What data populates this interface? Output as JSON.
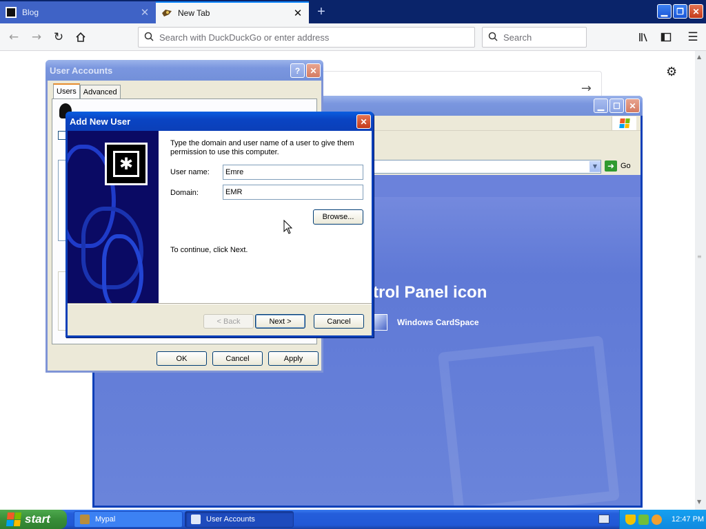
{
  "browser": {
    "tabs": [
      {
        "label": "Blog",
        "active": false
      },
      {
        "label": "New Tab",
        "active": true
      }
    ],
    "close_glyph": "✕",
    "new_tab_glyph": "+",
    "address_placeholder": "Search with DuckDuckGo or enter address",
    "search_placeholder": "Search",
    "icons": [
      "back-arrow-icon",
      "forward-arrow-icon",
      "reload-icon",
      "home-icon",
      "search-icon",
      "library-icon",
      "sidebar-icon",
      "menu-icon",
      "gear-icon"
    ]
  },
  "control_panel": {
    "heading": "trol Panel icon",
    "address_go": "Go",
    "item_cardspace": "Windows CardSpace"
  },
  "user_accounts": {
    "title": "User Accounts",
    "tabs": [
      "Users",
      "Advanced"
    ],
    "buttons": {
      "ok": "OK",
      "cancel": "Cancel",
      "apply": "Apply"
    }
  },
  "add_new_user": {
    "title": "Add New User",
    "instructions": "Type the domain and user name of a user to give them permission to use this computer.",
    "user_name_label": "User name:",
    "user_name_value": "Emre",
    "domain_label": "Domain:",
    "domain_value": "EMR",
    "browse_button": "Browse...",
    "continue_text": "To continue, click Next.",
    "back_button": "< Back",
    "next_button": "Next >",
    "cancel_button": "Cancel"
  },
  "taskbar": {
    "start_label": "start",
    "tasks": [
      "Mypal",
      "User Accounts"
    ],
    "clock": "12:47 PM"
  },
  "colors": {
    "xp_title_blue": "#0a44c3",
    "xp_face": "#ece9d8",
    "taskbar_blue": "#245edb",
    "start_green": "#388e38"
  }
}
